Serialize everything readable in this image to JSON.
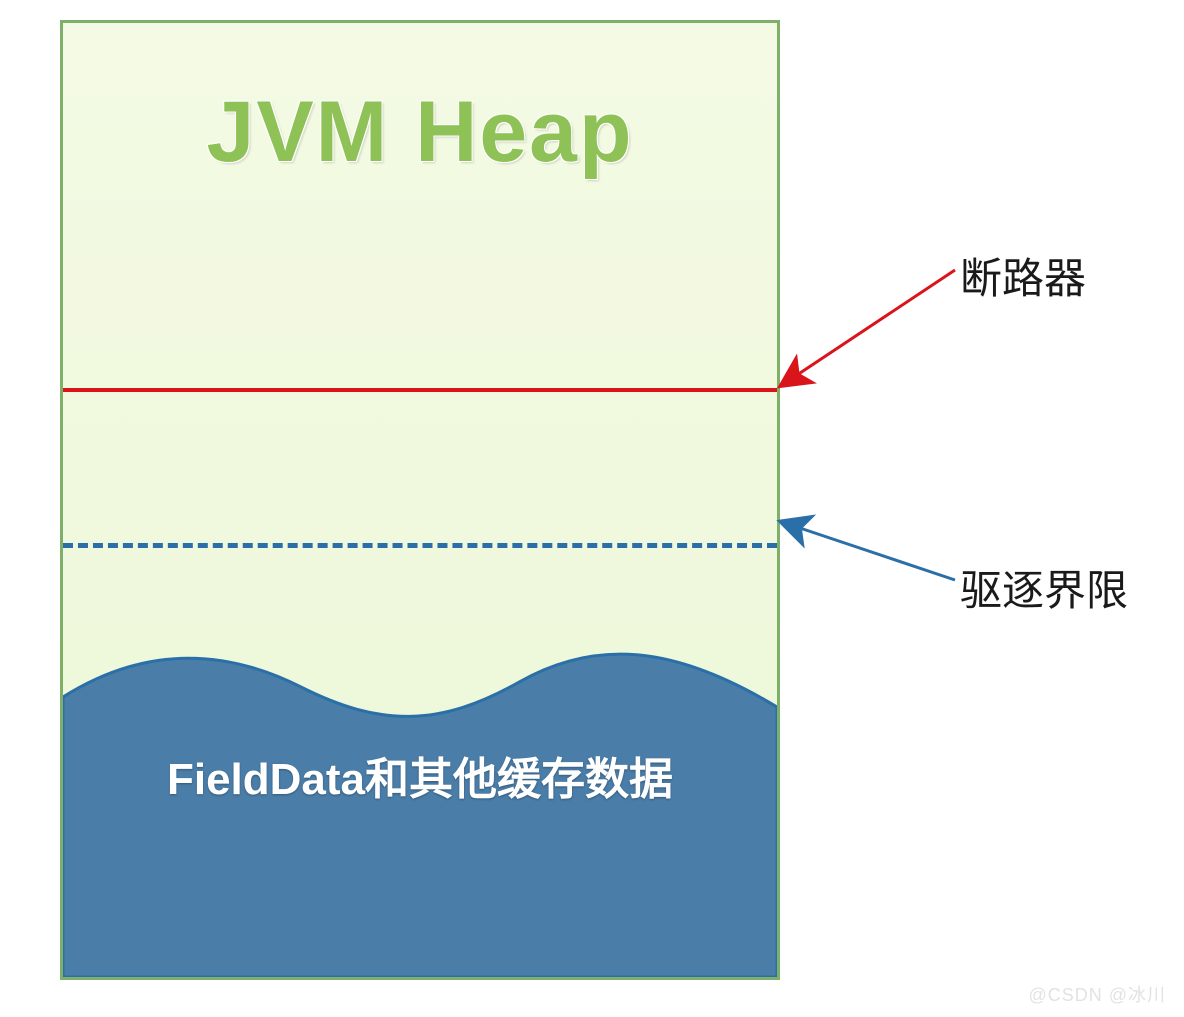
{
  "diagram": {
    "title": "JVM Heap",
    "breaker_label": "断路器",
    "eviction_label": "驱逐界限",
    "cache_label": "FieldData和其他缓存数据"
  },
  "colors": {
    "box_border": "#7fb069",
    "box_bg_top": "#f4fae4",
    "box_bg_bottom": "#ecf6d5",
    "title_text": "#8fc256",
    "breaker_line": "#d9141b",
    "eviction_line": "#2a6fa7",
    "wave_fill": "#4a7da8",
    "wave_stroke": "#2a6fa7"
  },
  "watermark": "@CSDN @冰川"
}
